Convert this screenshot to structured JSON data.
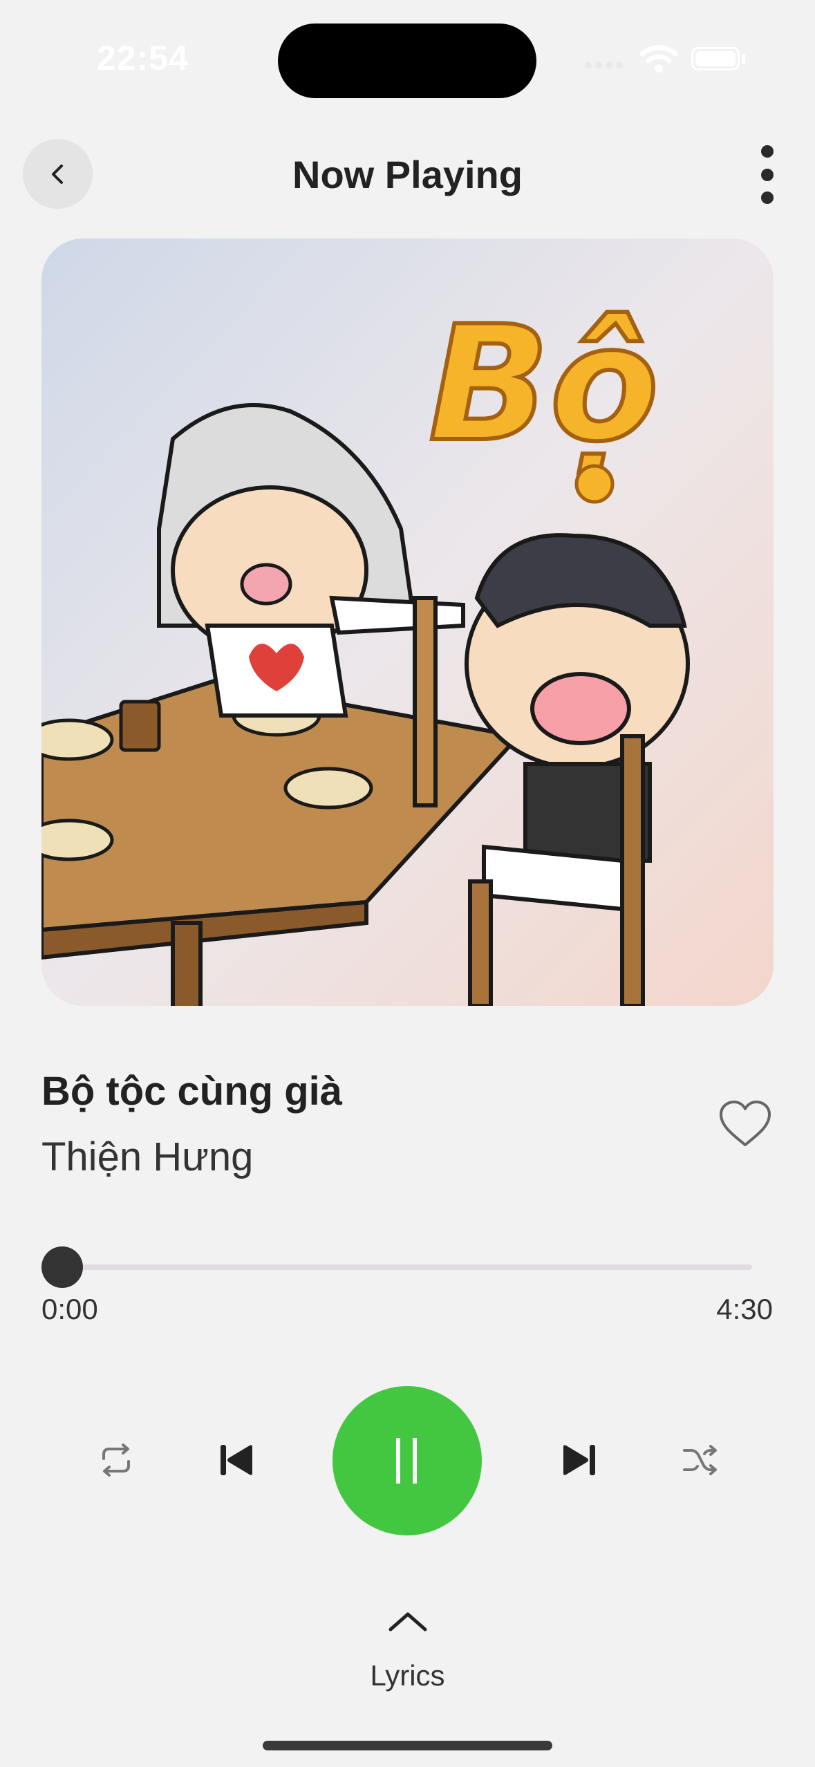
{
  "status_bar": {
    "time": "22:54"
  },
  "header": {
    "title": "Now Playing"
  },
  "artwork": {
    "title_lettering": "Bộ"
  },
  "track": {
    "title": "Bộ tộc cùng già",
    "artist": "Thiện Hưng",
    "liked": false
  },
  "progress": {
    "elapsed": "0:00",
    "total": "4:30",
    "fraction": 0
  },
  "controls": {
    "repeat_icon": "repeat-icon",
    "previous_icon": "skip-previous-icon",
    "play_state": "playing",
    "next_icon": "skip-next-icon",
    "shuffle_icon": "shuffle-icon"
  },
  "lyrics": {
    "label": "Lyrics"
  },
  "colors": {
    "accent": "#43c741",
    "background": "#f2f2f2",
    "text": "#222222"
  }
}
